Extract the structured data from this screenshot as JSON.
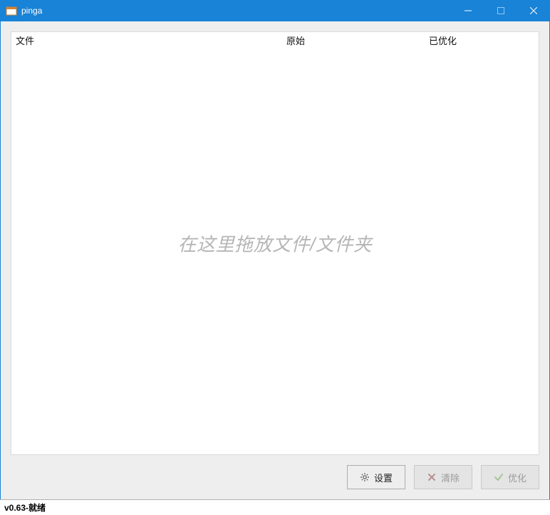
{
  "window": {
    "title": "pinga"
  },
  "columns": {
    "file": "文件",
    "original": "原始",
    "optimized": "已优化"
  },
  "drop_hint": "在这里拖放文件/文件夹",
  "buttons": {
    "settings": "设置",
    "clear": "清除",
    "optimize": "优化"
  },
  "status": {
    "version": "v0.63",
    "sep": " - ",
    "state": "就绪"
  },
  "colors": {
    "accent": "#1883d7"
  }
}
